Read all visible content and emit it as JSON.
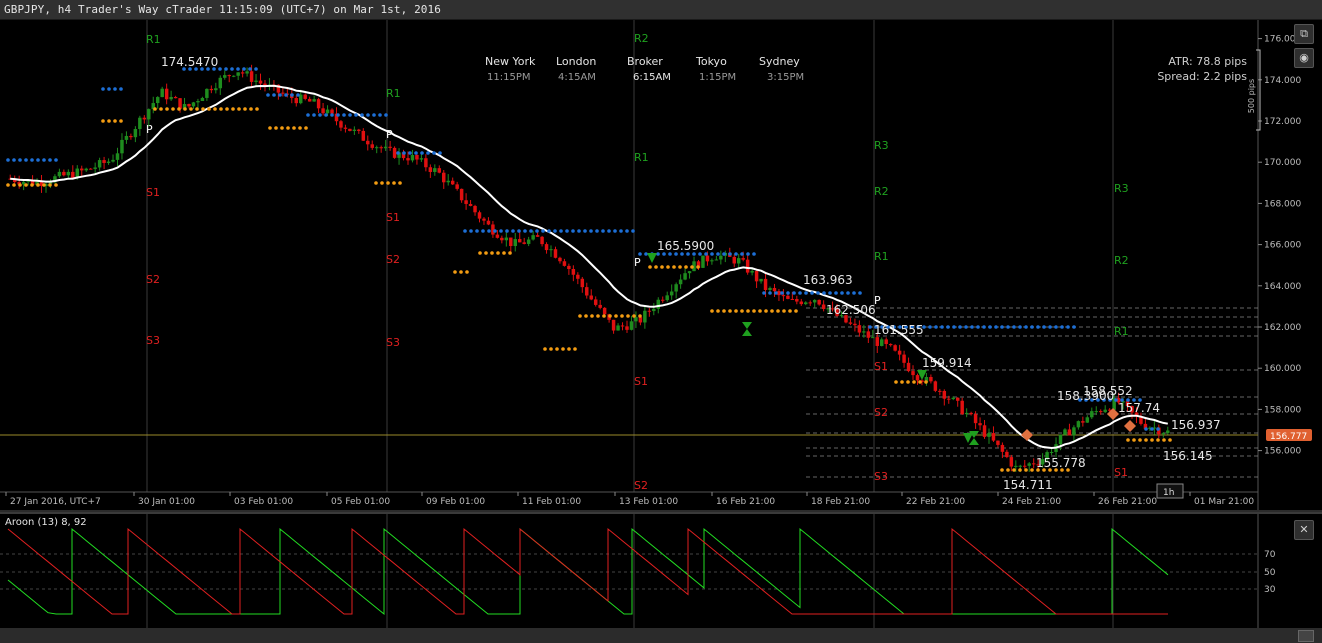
{
  "window": {
    "title": "GBPJPY, h4 Trader's Way cTrader 11:15:09 (UTC+7) on Mar 1st, 2016"
  },
  "sessions": [
    {
      "name": "New York",
      "time": "11:15PM"
    },
    {
      "name": "London",
      "time": "4:15AM"
    },
    {
      "name": "Broker",
      "time": "6:15AM"
    },
    {
      "name": "Tokyo",
      "time": "1:15PM"
    },
    {
      "name": "Sydney",
      "time": "3:15PM"
    }
  ],
  "info": {
    "atr": "ATR: 78.8 pips",
    "spread": "Spread: 2.2 pips",
    "scale_label": "500 pips"
  },
  "price_axis": {
    "labels": [
      "176.000",
      "174.000",
      "172.000",
      "170.000",
      "168.000",
      "166.000",
      "164.000",
      "162.000",
      "160.000",
      "158.000",
      "156.000"
    ],
    "current_price": "156.777"
  },
  "time_axis": {
    "labels": [
      "27 Jan 2016, UTC+7",
      "30 Jan 01:00",
      "03 Feb 01:00",
      "05 Feb 01:00",
      "09 Feb 01:00",
      "11 Feb 01:00",
      "13 Feb 01:00",
      "16 Feb 21:00",
      "18 Feb 21:00",
      "22 Feb 21:00",
      "24 Feb 21:00",
      "26 Feb 21:00",
      "01 Mar 21:00"
    ],
    "timeframe_badge": "1h"
  },
  "pivots": [
    {
      "label": "R1",
      "color": "#1fa01f"
    },
    {
      "label": "P",
      "color": "#ffffff"
    },
    {
      "label": "S1",
      "color": "#e02020"
    },
    {
      "label": "S2",
      "color": "#e02020"
    },
    {
      "label": "S3",
      "color": "#e02020"
    },
    {
      "label": "R1",
      "color": "#1fa01f"
    },
    {
      "label": "P",
      "color": "#ffffff"
    },
    {
      "label": "S1",
      "color": "#e02020"
    },
    {
      "label": "S2",
      "color": "#e02020"
    },
    {
      "label": "S3",
      "color": "#e02020"
    },
    {
      "label": "R2",
      "color": "#1fa01f"
    },
    {
      "label": "R1",
      "color": "#1fa01f"
    },
    {
      "label": "P",
      "color": "#ffffff"
    },
    {
      "label": "S1",
      "color": "#e02020"
    },
    {
      "label": "S2",
      "color": "#e02020"
    },
    {
      "label": "R3",
      "color": "#1fa01f"
    },
    {
      "label": "R2",
      "color": "#1fa01f"
    },
    {
      "label": "R1",
      "color": "#1fa01f"
    },
    {
      "label": "P",
      "color": "#ffffff"
    },
    {
      "label": "S1",
      "color": "#e02020"
    },
    {
      "label": "S2",
      "color": "#e02020"
    },
    {
      "label": "S3",
      "color": "#e02020"
    },
    {
      "label": "R3",
      "color": "#1fa01f"
    },
    {
      "label": "R2",
      "color": "#1fa01f"
    },
    {
      "label": "R1",
      "color": "#1fa01f"
    },
    {
      "label": "S1",
      "color": "#e02020"
    }
  ],
  "price_labels": [
    "174.5470",
    "165.5900",
    "163.963",
    "162.506",
    "161.555",
    "159.914",
    "158.3900",
    "158.552",
    "157.74",
    "156.937",
    "156.145",
    "155.778",
    "154.711"
  ],
  "indicator": {
    "title": "Aroon (13) 8, 92",
    "levels": [
      "70",
      "50",
      "30"
    ],
    "series": [
      {
        "name": "Aroon Up",
        "color": "#22dd22"
      },
      {
        "name": "Aroon Down",
        "color": "#e02020"
      }
    ]
  },
  "colors": {
    "bull": "#1e8c1e",
    "bear": "#e01010",
    "ma": "#ffffff",
    "dots_blue": "#1d6fd6",
    "dots_orange": "#f39c12",
    "price_line": "#9a8a2a",
    "price_tag": "#e06030"
  },
  "chart_data": {
    "type": "candlestick",
    "symbol": "GBPJPY",
    "timeframe": "h4",
    "ylim": [
      154.0,
      176.5
    ],
    "current_price": 156.777,
    "sessions": [
      "27 Jan",
      "30 Jan",
      "03 Feb",
      "05 Feb",
      "09 Feb",
      "11 Feb",
      "13 Feb",
      "16 Feb",
      "18 Feb",
      "22 Feb",
      "24 Feb",
      "26 Feb",
      "01 Mar"
    ],
    "close_path": [
      169.2,
      169.0,
      169.3,
      169.6,
      170.1,
      171.8,
      173.4,
      172.6,
      173.7,
      174.5,
      173.8,
      173.2,
      172.9,
      172.0,
      171.2,
      170.5,
      170.2,
      169.5,
      168.2,
      166.9,
      166.0,
      166.3,
      165.2,
      163.5,
      161.9,
      162.3,
      163.6,
      164.9,
      165.5,
      165.2,
      163.9,
      163.2,
      163.4,
      162.4,
      161.6,
      160.9,
      159.7,
      158.9,
      157.8,
      156.5,
      155.1,
      155.6,
      156.9,
      157.8,
      158.4,
      157.3,
      156.9
    ]
  }
}
